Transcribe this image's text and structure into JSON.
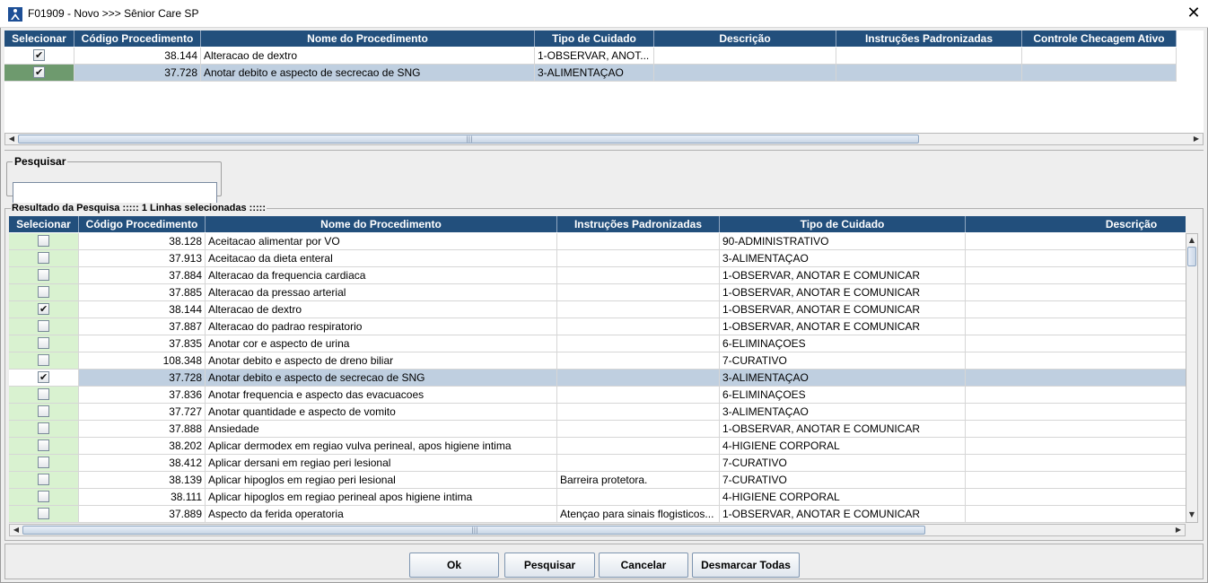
{
  "window": {
    "title": "F01909 - Novo >>> Sênior Care SP",
    "close_glyph": "✕"
  },
  "selected_grid": {
    "columns": [
      "Selecionar",
      "Código Procedimento",
      "Nome do Procedimento",
      "Tipo de Cuidado",
      "Descrição",
      "Instruções Padronizadas",
      "Controle Checagem Ativo"
    ],
    "rows": [
      {
        "checked": true,
        "codigo": "38.144",
        "nome": "Alteracao de dextro",
        "tipo": "1-OBSERVAR, ANOT...",
        "descricao": "",
        "instrucoes": "",
        "controle": ""
      },
      {
        "checked": true,
        "codigo": "37.728",
        "nome": "Anotar debito e aspecto de secrecao de SNG",
        "tipo": "3-ALIMENTAÇAO",
        "descricao": "",
        "instrucoes": "",
        "controle": "",
        "selected": true
      }
    ]
  },
  "search": {
    "legend": "Pesquisar",
    "value": "",
    "placeholder": ""
  },
  "results": {
    "legend": "Resultado da Pesquisa ::::: 1 Linhas selecionadas :::::",
    "columns": [
      "Selecionar",
      "Código Procedimento",
      "Nome do Procedimento",
      "Instruções Padronizadas",
      "Tipo de Cuidado",
      "Descrição"
    ],
    "rows": [
      {
        "checked": false,
        "codigo": "38.128",
        "nome": "Aceitacao alimentar por VO",
        "instrucoes": "",
        "tipo": "90-ADMINISTRATIVO",
        "descricao": ""
      },
      {
        "checked": false,
        "codigo": "37.913",
        "nome": "Aceitacao da dieta enteral",
        "instrucoes": "",
        "tipo": "3-ALIMENTAÇAO",
        "descricao": ""
      },
      {
        "checked": false,
        "codigo": "37.884",
        "nome": "Alteracao da frequencia cardiaca",
        "instrucoes": "",
        "tipo": "1-OBSERVAR, ANOTAR E COMUNICAR",
        "descricao": ""
      },
      {
        "checked": false,
        "codigo": "37.885",
        "nome": "Alteracao da pressao arterial",
        "instrucoes": "",
        "tipo": "1-OBSERVAR, ANOTAR E COMUNICAR",
        "descricao": ""
      },
      {
        "checked": true,
        "codigo": "38.144",
        "nome": "Alteracao de dextro",
        "instrucoes": "",
        "tipo": "1-OBSERVAR, ANOTAR E COMUNICAR",
        "descricao": ""
      },
      {
        "checked": false,
        "codigo": "37.887",
        "nome": "Alteracao do padrao respiratorio",
        "instrucoes": "",
        "tipo": "1-OBSERVAR, ANOTAR E COMUNICAR",
        "descricao": ""
      },
      {
        "checked": false,
        "codigo": "37.835",
        "nome": "Anotar cor e aspecto de urina",
        "instrucoes": "",
        "tipo": "6-ELIMINAÇOES",
        "descricao": ""
      },
      {
        "checked": false,
        "codigo": "108.348",
        "nome": "Anotar debito e aspecto de dreno biliar",
        "instrucoes": "",
        "tipo": "7-CURATIVO",
        "descricao": ""
      },
      {
        "checked": true,
        "codigo": "37.728",
        "nome": "Anotar debito e aspecto de secrecao de SNG",
        "instrucoes": "",
        "tipo": "3-ALIMENTAÇAO",
        "descricao": "",
        "selected": true
      },
      {
        "checked": false,
        "codigo": "37.836",
        "nome": "Anotar frequencia e aspecto das evacuacoes",
        "instrucoes": "",
        "tipo": "6-ELIMINAÇOES",
        "descricao": ""
      },
      {
        "checked": false,
        "codigo": "37.727",
        "nome": "Anotar quantidade e aspecto de vomito",
        "instrucoes": "",
        "tipo": "3-ALIMENTAÇAO",
        "descricao": ""
      },
      {
        "checked": false,
        "codigo": "37.888",
        "nome": "Ansiedade",
        "instrucoes": "",
        "tipo": "1-OBSERVAR, ANOTAR E COMUNICAR",
        "descricao": ""
      },
      {
        "checked": false,
        "codigo": "38.202",
        "nome": "Aplicar dermodex em regiao vulva perineal, apos higiene intima",
        "instrucoes": "",
        "tipo": "4-HIGIENE CORPORAL",
        "descricao": ""
      },
      {
        "checked": false,
        "codigo": "38.412",
        "nome": "Aplicar dersani em regiao peri lesional",
        "instrucoes": "",
        "tipo": "7-CURATIVO",
        "descricao": ""
      },
      {
        "checked": false,
        "codigo": "38.139",
        "nome": "Aplicar hipoglos em regiao peri lesional",
        "instrucoes": "Barreira protetora.",
        "tipo": "7-CURATIVO",
        "descricao": ""
      },
      {
        "checked": false,
        "codigo": "38.111",
        "nome": "Aplicar hipoglos em regiao perineal apos higiene intima",
        "instrucoes": "",
        "tipo": "4-HIGIENE CORPORAL",
        "descricao": ""
      },
      {
        "checked": false,
        "codigo": "37.889",
        "nome": "Aspecto da ferida operatoria",
        "instrucoes": "Atençao para sinais flogisticos...",
        "tipo": "1-OBSERVAR, ANOTAR E COMUNICAR",
        "descricao": ""
      }
    ]
  },
  "buttons": {
    "ok": "Ok",
    "pesquisar": "Pesquisar",
    "cancelar": "Cancelar",
    "desmarcar": "Desmarcar Todas"
  },
  "icons": {
    "app": "app-logo-icon",
    "scroll_left": "◀",
    "scroll_right": "▶",
    "scroll_up": "▲",
    "scroll_down": "▼",
    "grip": "|||"
  },
  "colors": {
    "header_bg": "#224f7c",
    "select_col_bg": "#d9f2d0",
    "row_selected_bg": "#bfcfe0"
  }
}
